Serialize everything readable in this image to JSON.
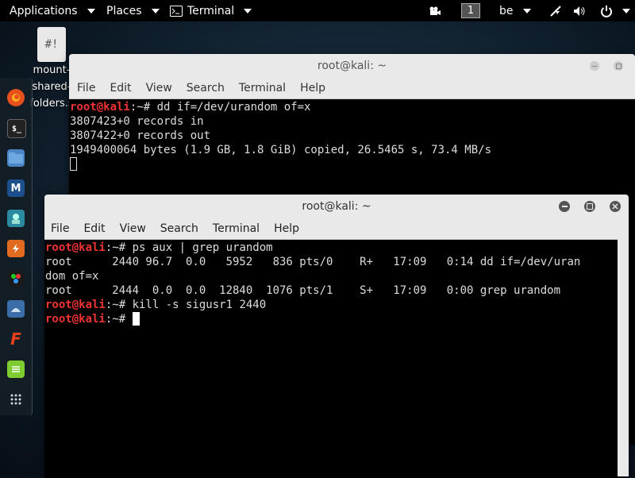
{
  "topbar": {
    "applications": "Applications",
    "places": "Places",
    "terminal": "Terminal",
    "workspace": "1",
    "keyboard_layout": "be"
  },
  "desktop_icon": {
    "name_line1": "mount-",
    "name_line2": "shared-",
    "name_line3": "folders.s"
  },
  "dock": {
    "icons": [
      "firefox-icon",
      "terminal-icon",
      "files-icon",
      "metasploit-icon",
      "armitage-icon",
      "burpsuite-icon",
      "maltego-icon",
      "beef-icon",
      "faraday-icon",
      "leafpad-icon",
      "show-apps-icon"
    ]
  },
  "window_back": {
    "title": "root@kali: ~",
    "menu": [
      "File",
      "Edit",
      "View",
      "Search",
      "Terminal",
      "Help"
    ],
    "lines": [
      {
        "prompt_user": "root@kali",
        "prompt_rest": ":~# ",
        "text": "dd if=/dev/urandom of=x"
      },
      {
        "text": "3807423+0 records in"
      },
      {
        "text": "3807422+0 records out"
      },
      {
        "text": "1949400064 bytes (1.9 GB, 1.8 GiB) copied, 26.5465 s, 73.4 MB/s"
      }
    ]
  },
  "window_front": {
    "title": "root@kali: ~",
    "menu": [
      "File",
      "Edit",
      "View",
      "Search",
      "Terminal",
      "Help"
    ],
    "lines": [
      {
        "prompt_user": "root@kali",
        "prompt_rest": ":~# ",
        "text": "ps aux | grep urandom"
      },
      {
        "text": "root      2440 96.7  0.0   5952   836 pts/0    R+   17:09   0:14 dd if=/dev/uran"
      },
      {
        "text": "dom of=x"
      },
      {
        "text": "root      2444  0.0  0.0  12840  1076 pts/1    S+   17:09   0:00 grep urandom"
      },
      {
        "prompt_user": "root@kali",
        "prompt_rest": ":~# ",
        "text": "kill -s sigusr1 2440"
      },
      {
        "prompt_user": "root@kali",
        "prompt_rest": ":~# ",
        "text": ""
      }
    ]
  }
}
